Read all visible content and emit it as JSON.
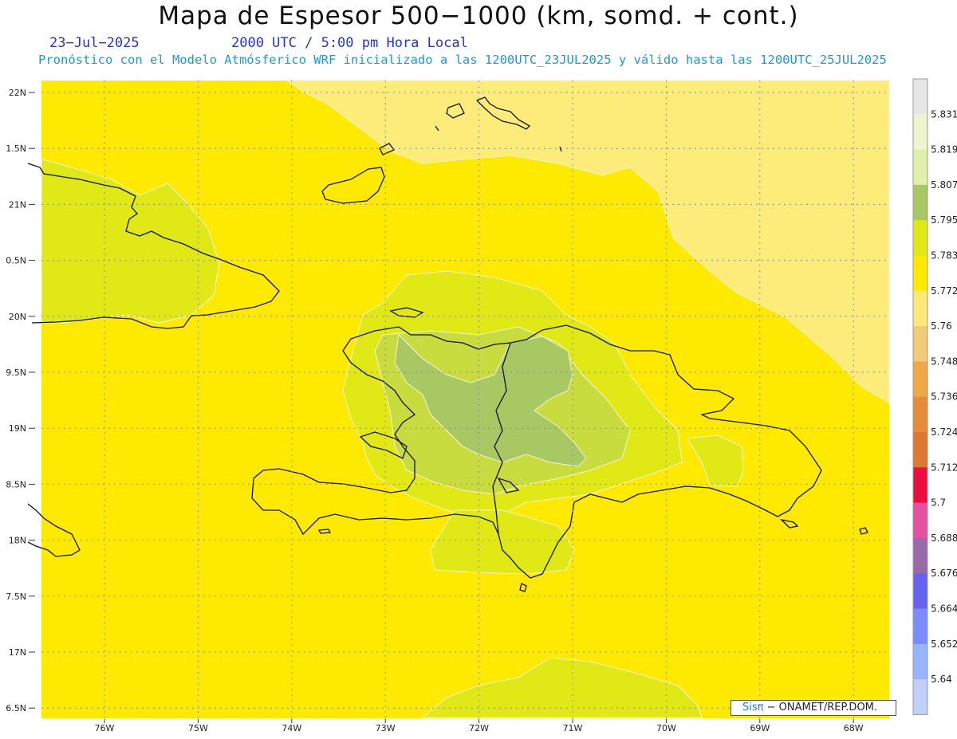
{
  "header": {
    "title": "Mapa de Espesor 500−1000 (km, somd. + cont.)",
    "date": "23−Jul−2025",
    "time": "2000 UTC / 5:00 pm Hora Local",
    "subtitle": "Pronóstico con el Modelo Atmósferico WRF inicializado a las 1200UTC_23JUL2025 y válido hasta las  1200UTC_25JUL2025"
  },
  "map": {
    "lat_labels": [
      "22N",
      "1.5N",
      "21N",
      "0.5N",
      "20N",
      "9.5N",
      "19N",
      "8.5N",
      "18N",
      "7.5N",
      "17N",
      "6.5N"
    ],
    "lon_labels": [
      "76W",
      "75W",
      "74W",
      "73W",
      "72W",
      "71W",
      "70W",
      "69W",
      "68W"
    ],
    "background_color": "#fdea00",
    "colors": {
      "pale": "#feec7a",
      "light_green": "#e0e816",
      "mid_green": "#c8dc40",
      "dark_green": "#a8c864"
    }
  },
  "colorbar": {
    "levels": [
      "5.831",
      "5.819",
      "5.807",
      "5.795",
      "5.783",
      "5.772",
      "5.76",
      "5.748",
      "5.736",
      "5.724",
      "5.712",
      "5.7",
      "5.688",
      "5.676",
      "5.664",
      "5.652",
      "5.64"
    ],
    "colors": [
      "#e6e6e6",
      "#eef4cc",
      "#e0f0a8",
      "#a8c864",
      "#e0e816",
      "#fdea00",
      "#fee87a",
      "#f0cc78",
      "#eea846",
      "#e48c38",
      "#dc7830",
      "#ec0c40",
      "#e650a0",
      "#9a6aa8",
      "#6464f0",
      "#7c8cfa",
      "#98b4fa",
      "#c0d0fa"
    ]
  },
  "credit": {
    "brand": "Sisπ",
    "org": "− ONAMET/REP.DOM."
  }
}
